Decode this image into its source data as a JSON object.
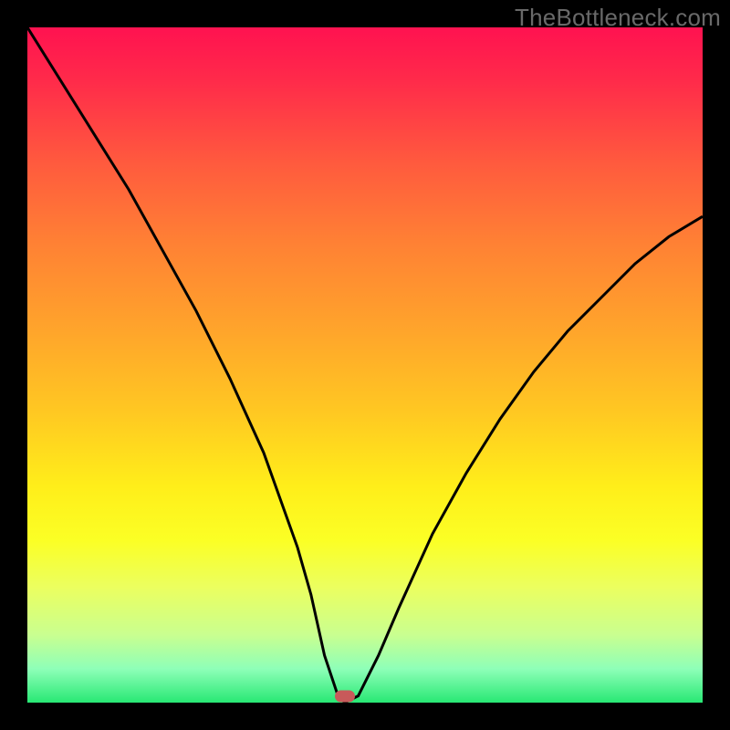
{
  "watermark": "TheBottleneck.com",
  "colors": {
    "frame": "#000000",
    "curve": "#000000",
    "marker": "#c85a5a",
    "gradient_stops": [
      "#ff1250",
      "#ff5a3e",
      "#ffa52b",
      "#ffee1a",
      "#c9ff90",
      "#28e874"
    ]
  },
  "chart_data": {
    "type": "line",
    "title": "",
    "xlabel": "",
    "ylabel": "",
    "xlim": [
      0,
      100
    ],
    "ylim": [
      0,
      100
    ],
    "grid": false,
    "legend": false,
    "series": [
      {
        "name": "bottleneck-curve",
        "x": [
          0,
          5,
          10,
          15,
          20,
          25,
          30,
          35,
          40,
          42,
          44,
          46,
          47,
          49,
          52,
          55,
          60,
          65,
          70,
          75,
          80,
          85,
          90,
          95,
          100
        ],
        "y": [
          100,
          92,
          84,
          76,
          67,
          58,
          48,
          37,
          23,
          16,
          7,
          1,
          0,
          1,
          7,
          14,
          25,
          34,
          42,
          49,
          55,
          60,
          65,
          69,
          72
        ]
      }
    ],
    "annotations": [
      {
        "name": "optimal-marker",
        "x": 47,
        "y": 1
      }
    ]
  }
}
